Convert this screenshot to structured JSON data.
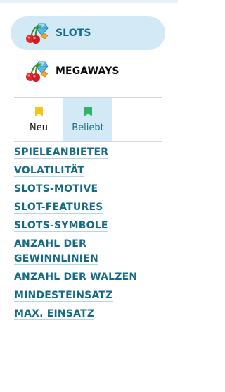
{
  "nav": {
    "items": [
      {
        "label": "SLOTS",
        "icon": "cherry-diamond-icon",
        "active": true
      },
      {
        "label": "MEGAWAYS",
        "icon": "cherry-diamond-icon",
        "active": false
      }
    ]
  },
  "tabs": [
    {
      "label": "Neu",
      "icon": "bookmark-icon",
      "color": "#f5c518",
      "active": false
    },
    {
      "label": "Beliebt",
      "icon": "bookmark-icon",
      "color": "#2fb36d",
      "active": true
    }
  ],
  "links": [
    "SPIELEANBIETER",
    "VOLATILITÄT",
    "SLOTS-MOTIVE",
    "SLOT-FEATURES",
    "SLOTS-SYMBOLE",
    "ANZAHL DER GEWINNLINIEN",
    "ANZAHL DER WALZEN",
    "MINDESTEINSATZ",
    "MAX. EINSATZ"
  ],
  "colors": {
    "accent": "#156b86",
    "active_bg": "#d3eaf6"
  }
}
